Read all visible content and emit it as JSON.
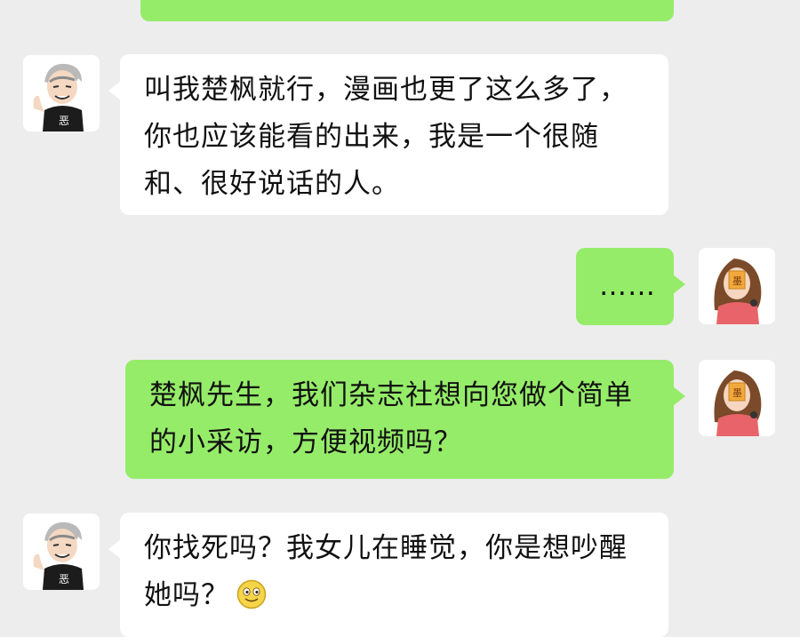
{
  "colors": {
    "background": "#ededed",
    "incoming_bubble": "#ffffff",
    "outgoing_bubble": "#95ec69",
    "text": "#111111"
  },
  "messages": [
    {
      "side": "right",
      "text": ""
    },
    {
      "side": "left",
      "text": "叫我楚枫就行，漫画也更了这么多了，你也应该能看的出来，我是一个很随和、很好说话的人。"
    },
    {
      "side": "right",
      "text": "……"
    },
    {
      "side": "right",
      "text": "楚枫先生，我们杂志社想向您做个简单的小采访，方便视频吗？"
    },
    {
      "side": "left",
      "text": "你找死吗？我女儿在睡觉，你是想吵醒她吗？",
      "emoji": "smile-emoji"
    }
  ],
  "avatars": {
    "left": {
      "icon": "man-avatar",
      "shirt_text": "恶"
    },
    "right": {
      "icon": "woman-avatar",
      "card_text": "墨"
    }
  }
}
